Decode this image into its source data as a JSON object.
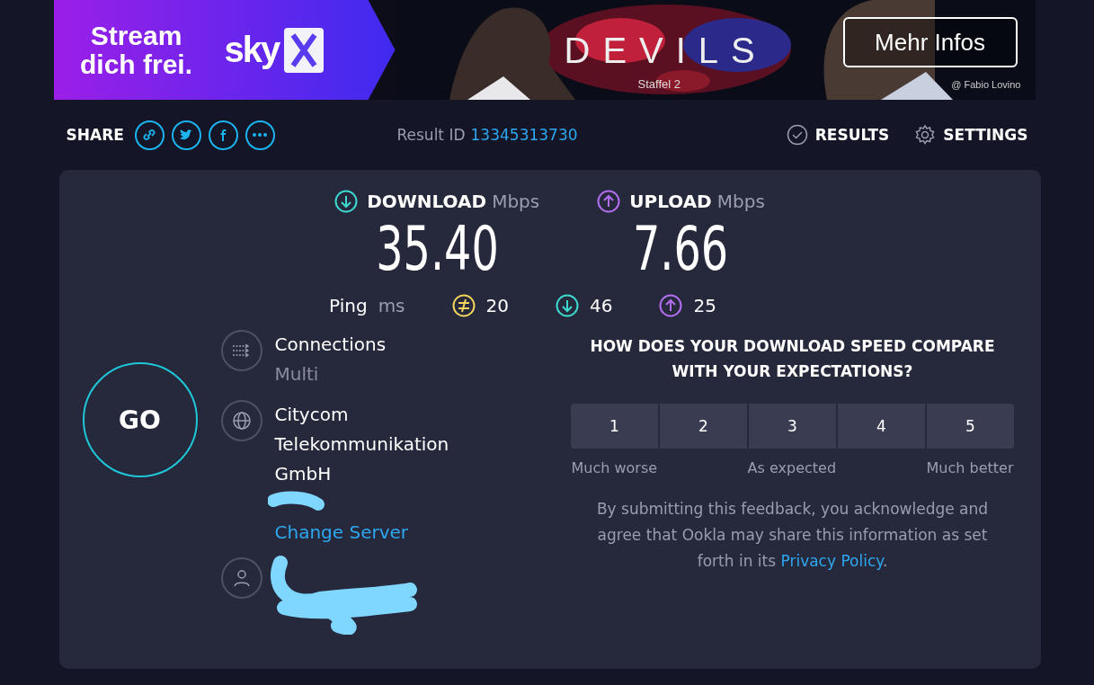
{
  "ad_banner": {
    "slogan": "Stream dich frei.",
    "brand": "sky",
    "show_title": "DEVILS",
    "season": "Staffel 2",
    "button": "Mehr Infos",
    "credit": "@ Fabio Lovino"
  },
  "toolbar": {
    "share_label": "SHARE",
    "share_icons": [
      {
        "kind": "link"
      },
      {
        "kind": "twitter"
      },
      {
        "kind": "facebook"
      },
      {
        "kind": "more"
      }
    ],
    "result_label": "Result ID",
    "result_id": "13345313730",
    "results": "RESULTS",
    "settings": "SETTINGS"
  },
  "speeds": [
    {
      "kind": "download",
      "label": "DOWNLOAD",
      "unit": "Mbps",
      "value": "35.40"
    },
    {
      "kind": "upload",
      "label": "UPLOAD",
      "unit": "Mbps",
      "value": "7.66"
    }
  ],
  "ping": {
    "label": "Ping",
    "unit": "ms",
    "values": [
      {
        "kind": "jitter",
        "value": "20"
      },
      {
        "kind": "download",
        "value": "46"
      },
      {
        "kind": "upload",
        "value": "25"
      }
    ]
  },
  "go_button": "GO",
  "connections": {
    "title": "Connections",
    "value": "Multi"
  },
  "provider": {
    "name": "Citycom Telekommunikation GmbH",
    "change_server": "Change Server"
  },
  "feedback": {
    "question": "HOW DOES YOUR DOWNLOAD SPEED COMPARE WITH YOUR EXPECTATIONS?",
    "ratings": [
      {
        "label": "1",
        "selected": false
      },
      {
        "label": "2",
        "selected": false
      },
      {
        "label": "3",
        "selected": false
      },
      {
        "label": "4",
        "selected": false
      },
      {
        "label": "5",
        "selected": false
      }
    ],
    "scale": [
      "Much worse",
      "As expected",
      "Much better"
    ],
    "disclaimer": "By submitting this feedback, you acknowledge and agree that Ookla may share this information as set forth in its",
    "policy_link": "Privacy Policy",
    "end": "."
  }
}
